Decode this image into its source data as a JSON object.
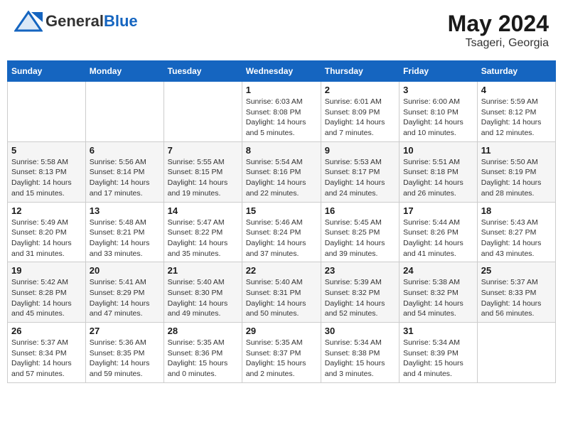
{
  "header": {
    "logo_general": "General",
    "logo_blue": "Blue",
    "month": "May 2024",
    "location": "Tsageri, Georgia"
  },
  "days_of_week": [
    "Sunday",
    "Monday",
    "Tuesday",
    "Wednesday",
    "Thursday",
    "Friday",
    "Saturday"
  ],
  "weeks": [
    [
      {
        "day": "",
        "sunrise": "",
        "sunset": "",
        "daylight": ""
      },
      {
        "day": "",
        "sunrise": "",
        "sunset": "",
        "daylight": ""
      },
      {
        "day": "",
        "sunrise": "",
        "sunset": "",
        "daylight": ""
      },
      {
        "day": "1",
        "sunrise": "Sunrise: 6:03 AM",
        "sunset": "Sunset: 8:08 PM",
        "daylight": "Daylight: 14 hours and 5 minutes."
      },
      {
        "day": "2",
        "sunrise": "Sunrise: 6:01 AM",
        "sunset": "Sunset: 8:09 PM",
        "daylight": "Daylight: 14 hours and 7 minutes."
      },
      {
        "day": "3",
        "sunrise": "Sunrise: 6:00 AM",
        "sunset": "Sunset: 8:10 PM",
        "daylight": "Daylight: 14 hours and 10 minutes."
      },
      {
        "day": "4",
        "sunrise": "Sunrise: 5:59 AM",
        "sunset": "Sunset: 8:12 PM",
        "daylight": "Daylight: 14 hours and 12 minutes."
      }
    ],
    [
      {
        "day": "5",
        "sunrise": "Sunrise: 5:58 AM",
        "sunset": "Sunset: 8:13 PM",
        "daylight": "Daylight: 14 hours and 15 minutes."
      },
      {
        "day": "6",
        "sunrise": "Sunrise: 5:56 AM",
        "sunset": "Sunset: 8:14 PM",
        "daylight": "Daylight: 14 hours and 17 minutes."
      },
      {
        "day": "7",
        "sunrise": "Sunrise: 5:55 AM",
        "sunset": "Sunset: 8:15 PM",
        "daylight": "Daylight: 14 hours and 19 minutes."
      },
      {
        "day": "8",
        "sunrise": "Sunrise: 5:54 AM",
        "sunset": "Sunset: 8:16 PM",
        "daylight": "Daylight: 14 hours and 22 minutes."
      },
      {
        "day": "9",
        "sunrise": "Sunrise: 5:53 AM",
        "sunset": "Sunset: 8:17 PM",
        "daylight": "Daylight: 14 hours and 24 minutes."
      },
      {
        "day": "10",
        "sunrise": "Sunrise: 5:51 AM",
        "sunset": "Sunset: 8:18 PM",
        "daylight": "Daylight: 14 hours and 26 minutes."
      },
      {
        "day": "11",
        "sunrise": "Sunrise: 5:50 AM",
        "sunset": "Sunset: 8:19 PM",
        "daylight": "Daylight: 14 hours and 28 minutes."
      }
    ],
    [
      {
        "day": "12",
        "sunrise": "Sunrise: 5:49 AM",
        "sunset": "Sunset: 8:20 PM",
        "daylight": "Daylight: 14 hours and 31 minutes."
      },
      {
        "day": "13",
        "sunrise": "Sunrise: 5:48 AM",
        "sunset": "Sunset: 8:21 PM",
        "daylight": "Daylight: 14 hours and 33 minutes."
      },
      {
        "day": "14",
        "sunrise": "Sunrise: 5:47 AM",
        "sunset": "Sunset: 8:22 PM",
        "daylight": "Daylight: 14 hours and 35 minutes."
      },
      {
        "day": "15",
        "sunrise": "Sunrise: 5:46 AM",
        "sunset": "Sunset: 8:24 PM",
        "daylight": "Daylight: 14 hours and 37 minutes."
      },
      {
        "day": "16",
        "sunrise": "Sunrise: 5:45 AM",
        "sunset": "Sunset: 8:25 PM",
        "daylight": "Daylight: 14 hours and 39 minutes."
      },
      {
        "day": "17",
        "sunrise": "Sunrise: 5:44 AM",
        "sunset": "Sunset: 8:26 PM",
        "daylight": "Daylight: 14 hours and 41 minutes."
      },
      {
        "day": "18",
        "sunrise": "Sunrise: 5:43 AM",
        "sunset": "Sunset: 8:27 PM",
        "daylight": "Daylight: 14 hours and 43 minutes."
      }
    ],
    [
      {
        "day": "19",
        "sunrise": "Sunrise: 5:42 AM",
        "sunset": "Sunset: 8:28 PM",
        "daylight": "Daylight: 14 hours and 45 minutes."
      },
      {
        "day": "20",
        "sunrise": "Sunrise: 5:41 AM",
        "sunset": "Sunset: 8:29 PM",
        "daylight": "Daylight: 14 hours and 47 minutes."
      },
      {
        "day": "21",
        "sunrise": "Sunrise: 5:40 AM",
        "sunset": "Sunset: 8:30 PM",
        "daylight": "Daylight: 14 hours and 49 minutes."
      },
      {
        "day": "22",
        "sunrise": "Sunrise: 5:40 AM",
        "sunset": "Sunset: 8:31 PM",
        "daylight": "Daylight: 14 hours and 50 minutes."
      },
      {
        "day": "23",
        "sunrise": "Sunrise: 5:39 AM",
        "sunset": "Sunset: 8:32 PM",
        "daylight": "Daylight: 14 hours and 52 minutes."
      },
      {
        "day": "24",
        "sunrise": "Sunrise: 5:38 AM",
        "sunset": "Sunset: 8:32 PM",
        "daylight": "Daylight: 14 hours and 54 minutes."
      },
      {
        "day": "25",
        "sunrise": "Sunrise: 5:37 AM",
        "sunset": "Sunset: 8:33 PM",
        "daylight": "Daylight: 14 hours and 56 minutes."
      }
    ],
    [
      {
        "day": "26",
        "sunrise": "Sunrise: 5:37 AM",
        "sunset": "Sunset: 8:34 PM",
        "daylight": "Daylight: 14 hours and 57 minutes."
      },
      {
        "day": "27",
        "sunrise": "Sunrise: 5:36 AM",
        "sunset": "Sunset: 8:35 PM",
        "daylight": "Daylight: 14 hours and 59 minutes."
      },
      {
        "day": "28",
        "sunrise": "Sunrise: 5:35 AM",
        "sunset": "Sunset: 8:36 PM",
        "daylight": "Daylight: 15 hours and 0 minutes."
      },
      {
        "day": "29",
        "sunrise": "Sunrise: 5:35 AM",
        "sunset": "Sunset: 8:37 PM",
        "daylight": "Daylight: 15 hours and 2 minutes."
      },
      {
        "day": "30",
        "sunrise": "Sunrise: 5:34 AM",
        "sunset": "Sunset: 8:38 PM",
        "daylight": "Daylight: 15 hours and 3 minutes."
      },
      {
        "day": "31",
        "sunrise": "Sunrise: 5:34 AM",
        "sunset": "Sunset: 8:39 PM",
        "daylight": "Daylight: 15 hours and 4 minutes."
      },
      {
        "day": "",
        "sunrise": "",
        "sunset": "",
        "daylight": ""
      }
    ]
  ]
}
